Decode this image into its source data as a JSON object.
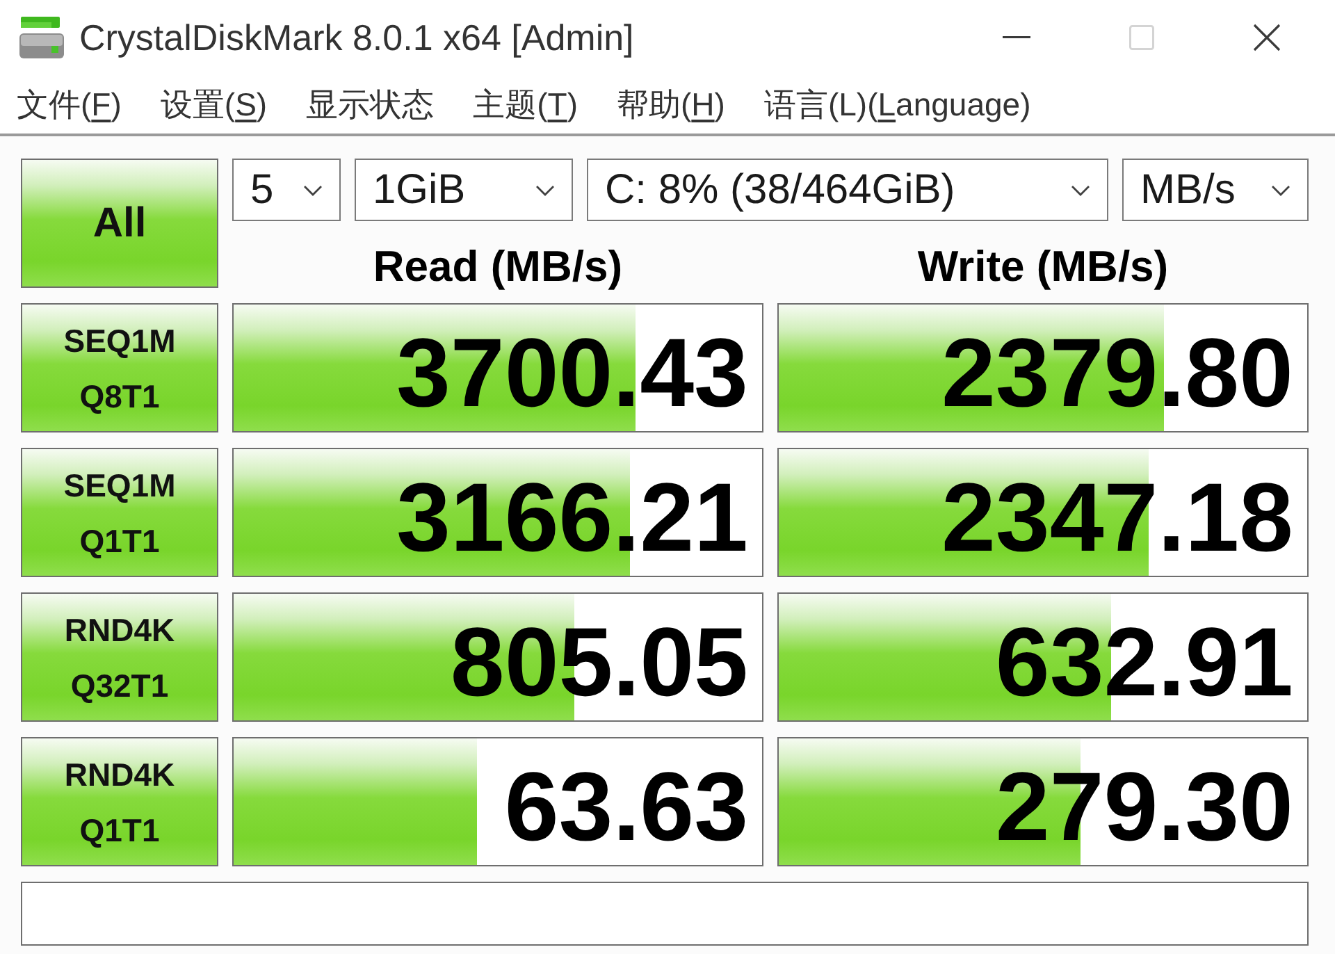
{
  "window": {
    "title": "CrystalDiskMark 8.0.1 x64 [Admin]",
    "controls": [
      {
        "kind": "minimize",
        "disabled": false
      },
      {
        "kind": "maximize",
        "disabled": true
      },
      {
        "kind": "close",
        "disabled": false
      }
    ]
  },
  "menu": [
    {
      "parts": [
        {
          "text": "文件(",
          "underlined": false
        },
        {
          "text": "F",
          "underlined": true
        },
        {
          "text": ")",
          "underlined": false
        }
      ]
    },
    {
      "parts": [
        {
          "text": "设置(",
          "underlined": false
        },
        {
          "text": "S",
          "underlined": true
        },
        {
          "text": ")",
          "underlined": false
        }
      ]
    },
    {
      "parts": [
        {
          "text": "显示状态",
          "underlined": false
        }
      ]
    },
    {
      "parts": [
        {
          "text": "主题(",
          "underlined": false
        },
        {
          "text": "T",
          "underlined": true
        },
        {
          "text": ")",
          "underlined": false
        }
      ]
    },
    {
      "parts": [
        {
          "text": "帮助(",
          "underlined": false
        },
        {
          "text": "H",
          "underlined": true
        },
        {
          "text": ")",
          "underlined": false
        }
      ]
    },
    {
      "parts": [
        {
          "text": "语言(L)(",
          "underlined": false
        },
        {
          "text": "L",
          "underlined": true
        },
        {
          "text": "anguage)",
          "underlined": false
        }
      ]
    }
  ],
  "run_all_button": "All",
  "selects": [
    {
      "kind": "count",
      "value": "5"
    },
    {
      "kind": "size",
      "value": "1GiB"
    },
    {
      "kind": "drive",
      "value": "C: 8% (38/464GiB)"
    },
    {
      "kind": "unit",
      "value": "MB/s"
    }
  ],
  "columns": [
    "Read (MB/s)",
    "Write (MB/s)"
  ],
  "tests": [
    {
      "label_lines": [
        "SEQ1M",
        "Q8T1"
      ],
      "read": {
        "value": "3700.43",
        "level": 0.76
      },
      "write": {
        "value": "2379.80",
        "level": 0.728
      }
    },
    {
      "label_lines": [
        "SEQ1M",
        "Q1T1"
      ],
      "read": {
        "value": "3166.21",
        "level": 0.75
      },
      "write": {
        "value": "2347.18",
        "level": 0.7
      }
    },
    {
      "label_lines": [
        "RND4K",
        "Q32T1"
      ],
      "read": {
        "value": "805.05",
        "level": 0.644
      },
      "write": {
        "value": "632.91",
        "level": 0.628
      }
    },
    {
      "label_lines": [
        "RND4K",
        "Q1T1"
      ],
      "read": {
        "value": "63.63",
        "level": 0.46
      },
      "write": {
        "value": "279.30",
        "level": 0.571
      }
    }
  ]
}
